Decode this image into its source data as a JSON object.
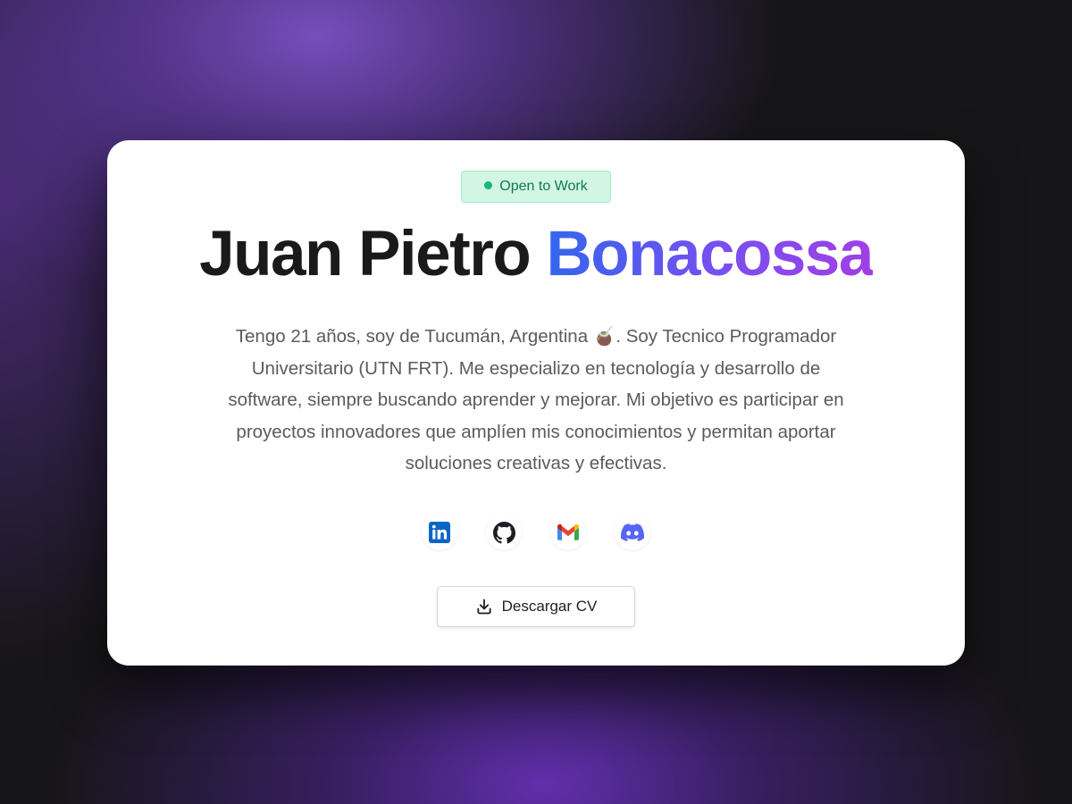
{
  "status_badge": {
    "label": "Open to Work",
    "dot_color": "#16b873"
  },
  "hero": {
    "first_name": "Juan Pietro",
    "last_name": "Bonacossa",
    "name_gradient": [
      "#3366ee",
      "#a03fe6"
    ],
    "bio_lines": [
      "Tengo 21 años, soy de Tucumán, Argentina 🧉. Soy Tecnico Programador",
      "Universitario (UTN FRT). Me especializo en tecnología y desarrollo de",
      "software, siempre buscando aprender y mejorar. Mi objetivo es participar en",
      "proyectos innovadores que amplíen mis conocimientos y permitan aportar",
      "soluciones creativas y efectivas."
    ]
  },
  "socials": [
    {
      "icon": "linkedin-icon",
      "color": "#0a66c2"
    },
    {
      "icon": "github-icon",
      "color": "#1b1f23"
    },
    {
      "icon": "gmail-icon",
      "color": "#ea4335"
    },
    {
      "icon": "discord-icon",
      "color": "#5865f2"
    }
  ],
  "cv_button": {
    "label": "Descargar CV",
    "icon": "download-icon"
  }
}
